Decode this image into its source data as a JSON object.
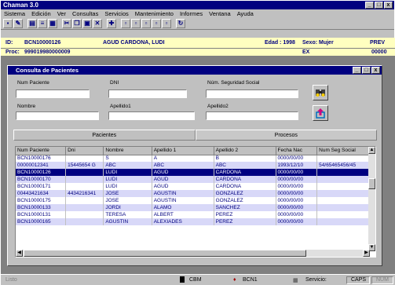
{
  "app": {
    "title": "Chaman 3.0"
  },
  "menu": [
    "Sistema",
    "Edición",
    "Ver",
    "Consultas",
    "Servicios",
    "Mantenimiento",
    "Informes",
    "Ventana",
    "Ayuda"
  ],
  "patient": {
    "id_label": "ID:",
    "id_value": "BCN10000126",
    "name": "AGUD CARDONA, LUDI",
    "edad_label": "Edad : 1998",
    "sexo_label": "Sexo: Mujer",
    "prev_label": "PREV",
    "proc_label": "Proc:",
    "proc_value": "999019980000009",
    "ex_label": "EX",
    "num_value": "00000"
  },
  "dialog": {
    "title": "Consulta de Pacientes",
    "labels": {
      "num_paciente": "Num Paciente",
      "dni": "DNI",
      "num_ss": "Núm. Seguridad Social",
      "nombre": "Nombre",
      "apellido1": "Apellido1",
      "apellido2": "Apellido2"
    },
    "tabs": [
      "Pacientes",
      "Procesos"
    ]
  },
  "table": {
    "columns": [
      "Num Paciente",
      "Dni",
      "Nombre",
      "Apellido 1",
      "Apellido 2",
      "Fecha Nac",
      "Num Seg Social"
    ],
    "rows": [
      [
        "BCN10000176",
        "",
        "S",
        "A",
        "B",
        "0000/00/00",
        ""
      ],
      [
        "00000012341",
        "15445654 G",
        "ABC",
        "ABC",
        "ABC",
        "1993/12/10",
        "54/65465456/45"
      ],
      [
        "BCN10000126",
        "",
        "LUDI",
        "AGUD",
        "CARDONA",
        "0000/00/00",
        ""
      ],
      [
        "BCN10000170",
        "",
        "LUDI",
        "AGUD",
        "CARDONA",
        "0000/00/00",
        ""
      ],
      [
        "BCN10000171",
        "",
        "LUDI",
        "AGUD",
        "CARDONA",
        "0000/00/00",
        ""
      ],
      [
        "00443421634",
        "4434216341",
        "JOSE",
        "AGUSTIN",
        "GONZALEZ",
        "0000/00/00",
        ""
      ],
      [
        "BCN10000175",
        "",
        "JOSE",
        "AGUSTIN",
        "GONZALEZ",
        "0000/00/00",
        ""
      ],
      [
        "BCN10000133",
        "",
        "JORDI",
        "ALAMO",
        "SANCHEZ",
        "0000/00/00",
        ""
      ],
      [
        "BCN10000131",
        "",
        "TERESA",
        "ALBERT",
        "PEREZ",
        "0000/00/00",
        ""
      ],
      [
        "BCN10000165",
        "",
        "AGUSTIN",
        "ALEXIADES",
        "PEREZ",
        "0000/00/00",
        ""
      ]
    ],
    "selected_row": 2
  },
  "status": {
    "left": "Listo",
    "cbm": "CBM",
    "bcn": "BCN1",
    "servicio": "Servicio:",
    "caps": "CAPS",
    "num": "NUM"
  }
}
